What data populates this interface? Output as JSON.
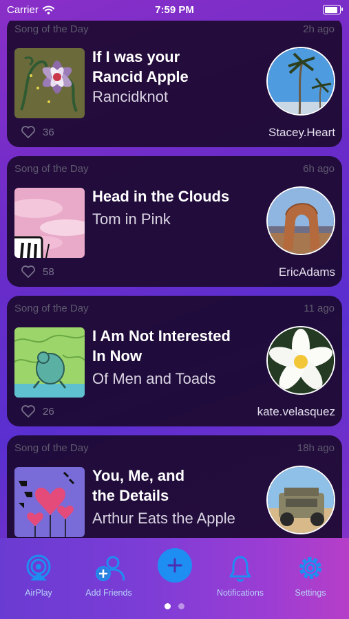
{
  "status_bar": {
    "carrier": "Carrier",
    "time": "7:59 PM"
  },
  "cards": [
    {
      "label": "Song of the Day",
      "time_ago": "2h ago",
      "title_lines": [
        "If I was your",
        "Rancid Apple"
      ],
      "artist": "Rancidknot",
      "likes": "36",
      "username": "Stacey.Heart"
    },
    {
      "label": "Song of the Day",
      "time_ago": "6h ago",
      "title_lines": [
        "Head in the Clouds"
      ],
      "artist": "Tom in Pink",
      "likes": "58",
      "username": "EricAdams"
    },
    {
      "label": "Song of the Day",
      "time_ago": "11 ago",
      "title_lines": [
        "I Am Not Interested",
        "In Now"
      ],
      "artist": "Of Men and Toads",
      "likes": "26",
      "username": "kate.velasquez"
    },
    {
      "label": "Song of the Day",
      "time_ago": "18h ago",
      "title_lines": [
        "You, Me, and",
        "the Details"
      ],
      "artist": "Arthur Eats the Apple",
      "likes": "",
      "username": ""
    }
  ],
  "tab_bar": {
    "airplay": "AirPlay",
    "add_friends": "Add Friends",
    "notifications": "Notifications",
    "settings": "Settings"
  },
  "colors": {
    "accent": "#1e8ef2",
    "tab_label": "#b8d4f8",
    "card_bg": "#180828"
  },
  "icons": [
    "wifi-icon",
    "battery-icon",
    "heart-icon",
    "airplay-icon",
    "add-friends-icon",
    "plus-icon",
    "bell-icon",
    "gear-icon"
  ],
  "pagination": {
    "total": 2,
    "current": 1
  }
}
